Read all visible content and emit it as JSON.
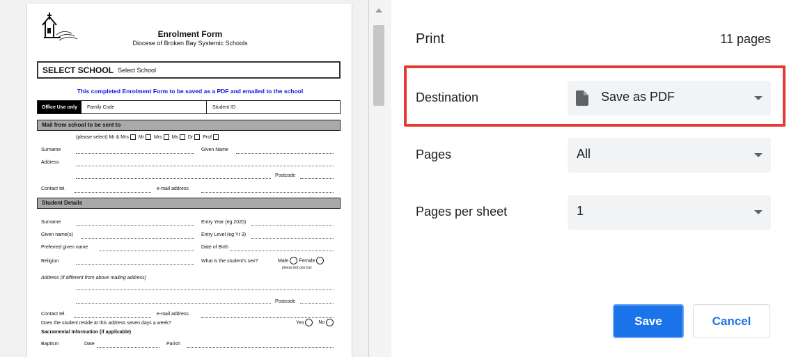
{
  "document": {
    "title": "Enrolment Form",
    "subtitle": "Diocese of Broken Bay Systemic Schools",
    "select_school_label": "SELECT SCHOOL",
    "select_school_value": "Select School",
    "note": "This completed Enrolment Form to be saved as a PDF and emailed to the school",
    "office_use": "Office Use only",
    "family_code": "Family Code",
    "student_id": "Student ID",
    "section_mail": "Mail from school to be sent to",
    "please_select": "(please select)  Mr & Mrs",
    "titles": [
      "Mr",
      "Mrs",
      "Ms",
      "Dr",
      "Prof"
    ],
    "surname": "Surname",
    "given_name": "Given Name",
    "address": "Address",
    "postcode": "Postcode",
    "contact_tel": "Contact tel.",
    "email_address": "e-mail address",
    "section_student": "Student Details",
    "entry_year": "Entry Year (eg 2020)",
    "given_names": "Given name(s)",
    "entry_level": "Entry Level (eg Yr 3)",
    "preferred_name": "Preferred given name",
    "dob": "Date of Birth",
    "religion": "Religion",
    "sex_question": "What is the student's sex?",
    "male": "Male",
    "female": "Female",
    "tick_one": "please tick one box",
    "address_diff": "Address  (if different from above mailing address)",
    "reside_question": "Does the student reside at this address seven days a week?",
    "yes": "Yes",
    "no": "No",
    "sacramental": "Sacramental Information (if applicable)",
    "baptism": "Baptism",
    "date": "Date",
    "parish": "Parish"
  },
  "panel": {
    "title": "Print",
    "page_count": "11 pages",
    "destination_label": "Destination",
    "destination_value": "Save as PDF",
    "pages_label": "Pages",
    "pages_value": "All",
    "pps_label": "Pages per sheet",
    "pps_value": "1",
    "save_label": "Save",
    "cancel_label": "Cancel"
  },
  "colors": {
    "accent": "#1a73e8",
    "highlight": "#e53935"
  }
}
